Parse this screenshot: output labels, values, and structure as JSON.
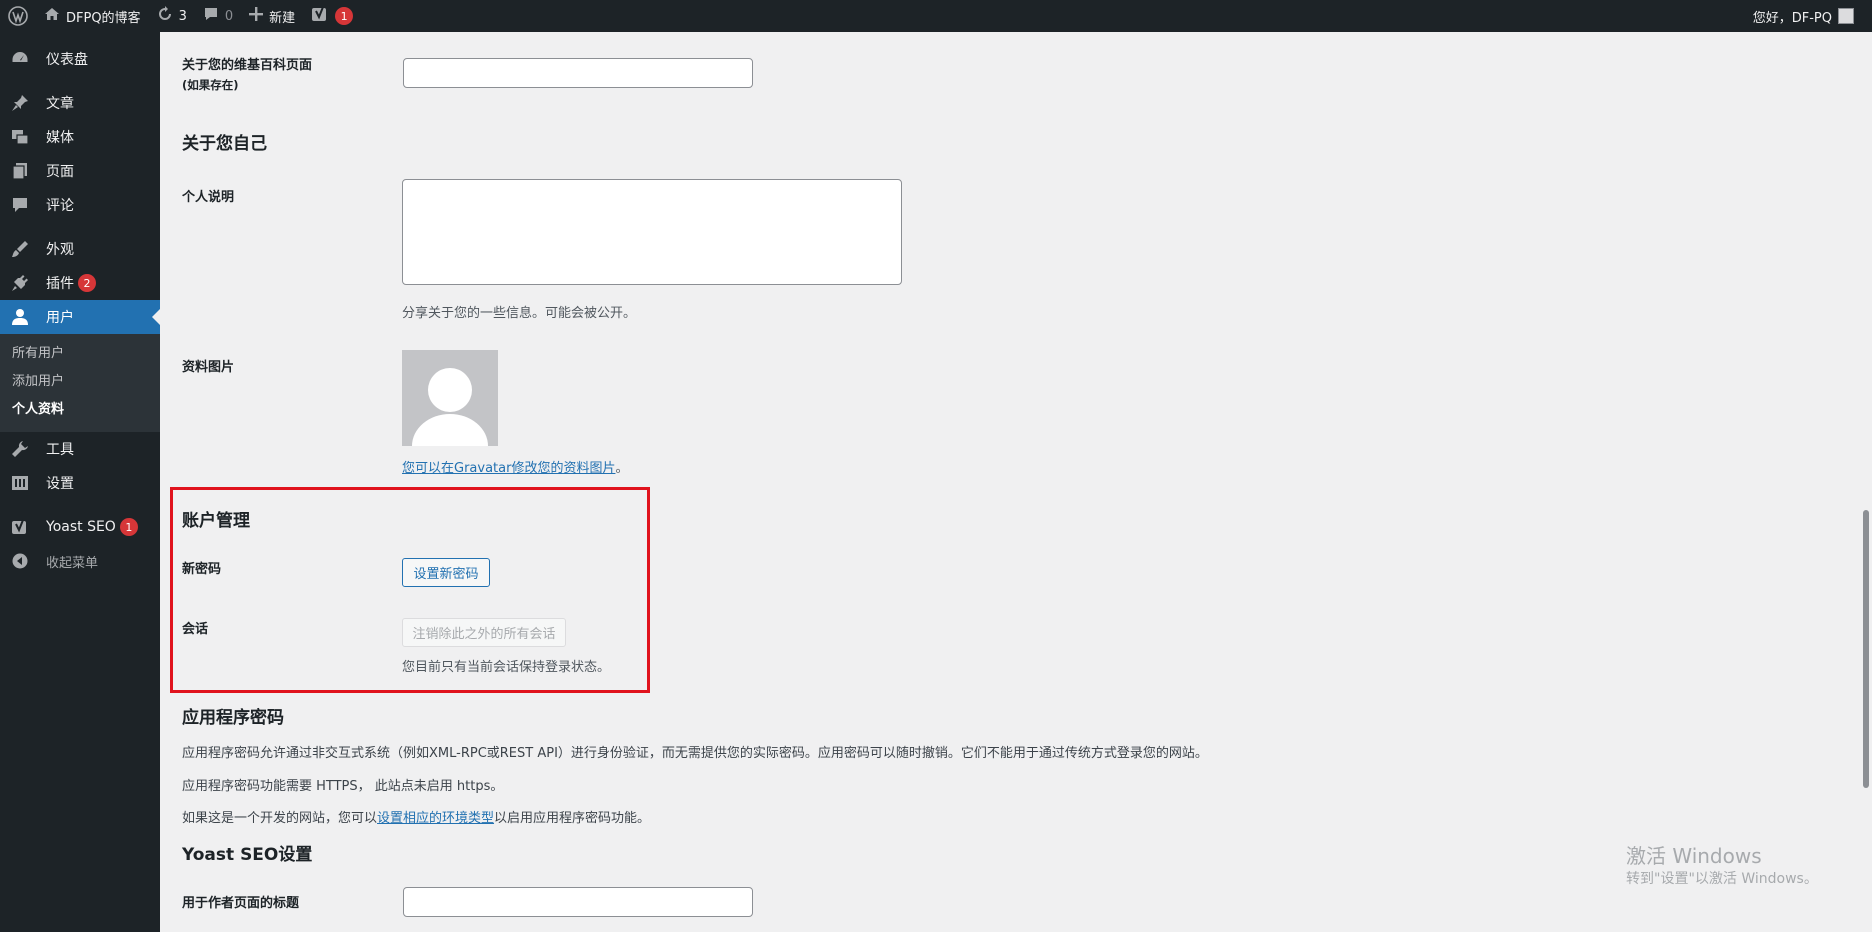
{
  "adminbar": {
    "site_name": "DFPQ的博客",
    "updates_count": "3",
    "comments_count": "0",
    "new_label": "新建",
    "yoast_badge": "1",
    "greeting": "您好，DF-PQ"
  },
  "sidebar": {
    "items": [
      {
        "label": "仪表盘",
        "icon": "dashboard-icon"
      },
      {
        "label": "文章",
        "icon": "pin-icon"
      },
      {
        "label": "媒体",
        "icon": "media-icon"
      },
      {
        "label": "页面",
        "icon": "page-icon"
      },
      {
        "label": "评论",
        "icon": "comment-icon"
      },
      {
        "label": "外观",
        "icon": "brush-icon"
      },
      {
        "label": "插件",
        "icon": "plugin-icon",
        "badge": "2"
      },
      {
        "label": "用户",
        "icon": "user-icon"
      },
      {
        "label": "工具",
        "icon": "wrench-icon"
      },
      {
        "label": "设置",
        "icon": "settings-icon"
      },
      {
        "label": "Yoast SEO",
        "icon": "yoast-icon",
        "badge": "1"
      },
      {
        "label": "收起菜单",
        "icon": "collapse-icon"
      }
    ],
    "submenu": [
      "所有用户",
      "添加用户",
      "个人资料"
    ]
  },
  "profile": {
    "wiki_label": "关于您的维基百科页面",
    "wiki_sub": "(如果存在)",
    "about_heading": "关于您自己",
    "bio_label": "个人说明",
    "bio_desc": "分享关于您的一些信息。可能会被公开。",
    "picture_label": "资料图片",
    "gravatar_text": "您可以在Gravatar修改您的资料图片",
    "gravatar_period": "。",
    "account_heading": "账户管理",
    "new_password_label": "新密码",
    "set_password_button": "设置新密码",
    "sessions_label": "会话",
    "logout_button": "注销除此之外的所有会话",
    "sessions_desc": "您目前只有当前会话保持登录状态。",
    "app_pw_heading": "应用程序密码",
    "app_pw_p1": "应用程序密码允许通过非交互式系统（例如XML-RPC或REST API）进行身份验证，而无需提供您的实际密码。应用密码可以随时撤销。它们不能用于通过传统方式登录您的网站。",
    "app_pw_p2": "应用程序密码功能需要 HTTPS， 此站点未启用 https。",
    "app_pw_p3_pre": "如果这是一个开发的网站，您可以",
    "app_pw_p3_link": "设置相应的环境类型",
    "app_pw_p3_post": "以启用应用程序密码功能。",
    "yoast_heading": "Yoast SEO设置",
    "author_title_label": "用于作者页面的标题"
  },
  "watermark": {
    "line1": "激活 Windows",
    "line2": "转到\"设置\"以激活 Windows。"
  },
  "colors": {
    "adminbar_bg": "#1d2327",
    "accent": "#2271b1",
    "badge": "#d63638",
    "highlight": "#e0131d"
  }
}
